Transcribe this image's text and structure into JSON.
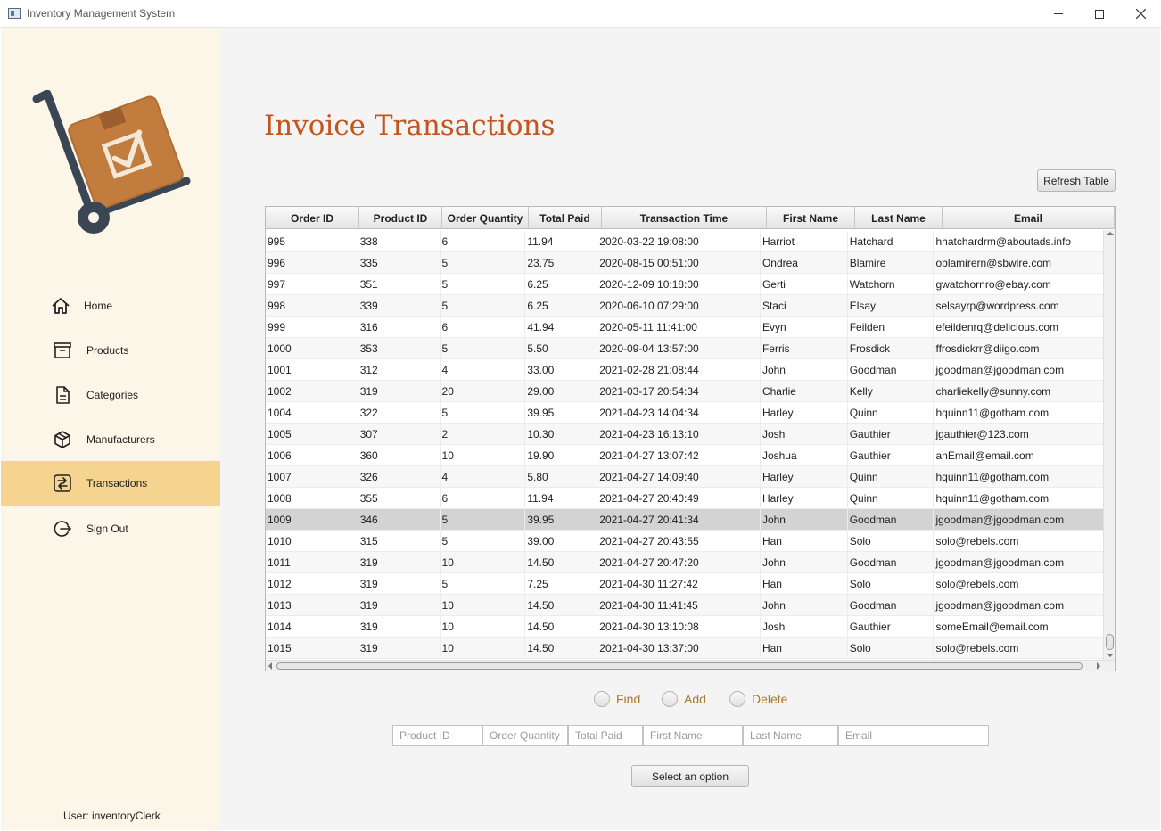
{
  "window": {
    "title": "Inventory Management System"
  },
  "sidebar": {
    "items": [
      {
        "label": "Home",
        "icon": "home-icon"
      },
      {
        "label": "Products",
        "icon": "archive-box-icon"
      },
      {
        "label": "Categories",
        "icon": "document-icon"
      },
      {
        "label": "Manufacturers",
        "icon": "cube-icon"
      },
      {
        "label": "Transactions",
        "icon": "transfer-icon",
        "active": true
      },
      {
        "label": "Sign Out",
        "icon": "sign-out-icon"
      }
    ],
    "user": "User: inventoryClerk"
  },
  "main": {
    "title": "Invoice Transactions",
    "refresh_label": "Refresh Table",
    "table": {
      "columns": [
        "Order ID",
        "Product ID",
        "Order Quantity",
        "Total Paid",
        "Transaction Time",
        "First Name",
        "Last Name",
        "Email"
      ],
      "rows": [
        [
          "995",
          "338",
          "6",
          "11.94",
          "2020-03-22 19:08:00",
          "Harriot",
          "Hatchard",
          "hhatchardrm@aboutads.info"
        ],
        [
          "996",
          "335",
          "5",
          "23.75",
          "2020-08-15 00:51:00",
          "Ondrea",
          "Blamire",
          "oblamirern@sbwire.com"
        ],
        [
          "997",
          "351",
          "5",
          "6.25",
          "2020-12-09 10:18:00",
          "Gerti",
          "Watchorn",
          "gwatchornro@ebay.com"
        ],
        [
          "998",
          "339",
          "5",
          "6.25",
          "2020-06-10 07:29:00",
          "Staci",
          "Elsay",
          "selsayrp@wordpress.com"
        ],
        [
          "999",
          "316",
          "6",
          "41.94",
          "2020-05-11 11:41:00",
          "Evyn",
          "Feilden",
          "efeildenrq@delicious.com"
        ],
        [
          "1000",
          "353",
          "5",
          "5.50",
          "2020-09-04 13:57:00",
          "Ferris",
          "Frosdick",
          "ffrosdickrr@diigo.com"
        ],
        [
          "1001",
          "312",
          "4",
          "33.00",
          "2021-02-28 21:08:44",
          "John",
          "Goodman",
          "jgoodman@jgoodman.com"
        ],
        [
          "1002",
          "319",
          "20",
          "29.00",
          "2021-03-17 20:54:34",
          "Charlie",
          "Kelly",
          "charliekelly@sunny.com"
        ],
        [
          "1004",
          "322",
          "5",
          "39.95",
          "2021-04-23 14:04:34",
          "Harley",
          "Quinn",
          "hquinn11@gotham.com"
        ],
        [
          "1005",
          "307",
          "2",
          "10.30",
          "2021-04-23 16:13:10",
          "Josh",
          "Gauthier",
          "jgauthier@123.com"
        ],
        [
          "1006",
          "360",
          "10",
          "19.90",
          "2021-04-27 13:07:42",
          "Joshua",
          "Gauthier",
          "anEmail@email.com"
        ],
        [
          "1007",
          "326",
          "4",
          "5.80",
          "2021-04-27 14:09:40",
          "Harley",
          "Quinn",
          "hquinn11@gotham.com"
        ],
        [
          "1008",
          "355",
          "6",
          "11.94",
          "2021-04-27 20:40:49",
          "Harley",
          "Quinn",
          "hquinn11@gotham.com"
        ],
        [
          "1009",
          "346",
          "5",
          "39.95",
          "2021-04-27 20:41:34",
          "John",
          "Goodman",
          "jgoodman@jgoodman.com"
        ],
        [
          "1010",
          "315",
          "5",
          "39.00",
          "2021-04-27 20:43:55",
          "Han",
          "Solo",
          "solo@rebels.com"
        ],
        [
          "1011",
          "319",
          "10",
          "14.50",
          "2021-04-27 20:47:20",
          "John",
          "Goodman",
          "jgoodman@jgoodman.com"
        ],
        [
          "1012",
          "319",
          "5",
          "7.25",
          "2021-04-30 11:27:42",
          "Han",
          "Solo",
          "solo@rebels.com"
        ],
        [
          "1013",
          "319",
          "10",
          "14.50",
          "2021-04-30 11:41:45",
          "John",
          "Goodman",
          "jgoodman@jgoodman.com"
        ],
        [
          "1014",
          "319",
          "10",
          "14.50",
          "2021-04-30 13:10:08",
          "Josh",
          "Gauthier",
          "someEmail@email.com"
        ],
        [
          "1015",
          "319",
          "10",
          "14.50",
          "2021-04-30 13:37:00",
          "Han",
          "Solo",
          "solo@rebels.com"
        ]
      ],
      "selected_row": 13
    },
    "options": [
      "Find",
      "Add",
      "Delete"
    ],
    "fields": {
      "product_id_placeholder": "Product ID",
      "order_quantity_placeholder": "Order Quantity",
      "total_paid_placeholder": "Total Paid",
      "first_name_placeholder": "First Name",
      "last_name_placeholder": "Last Name",
      "email_placeholder": "Email"
    },
    "submit_label": "Select an option"
  },
  "colors": {
    "sidebar_bg": "#fcf6e8",
    "active_nav": "#f5d48f",
    "title": "#c4541d",
    "radio_label": "#a8782a"
  }
}
